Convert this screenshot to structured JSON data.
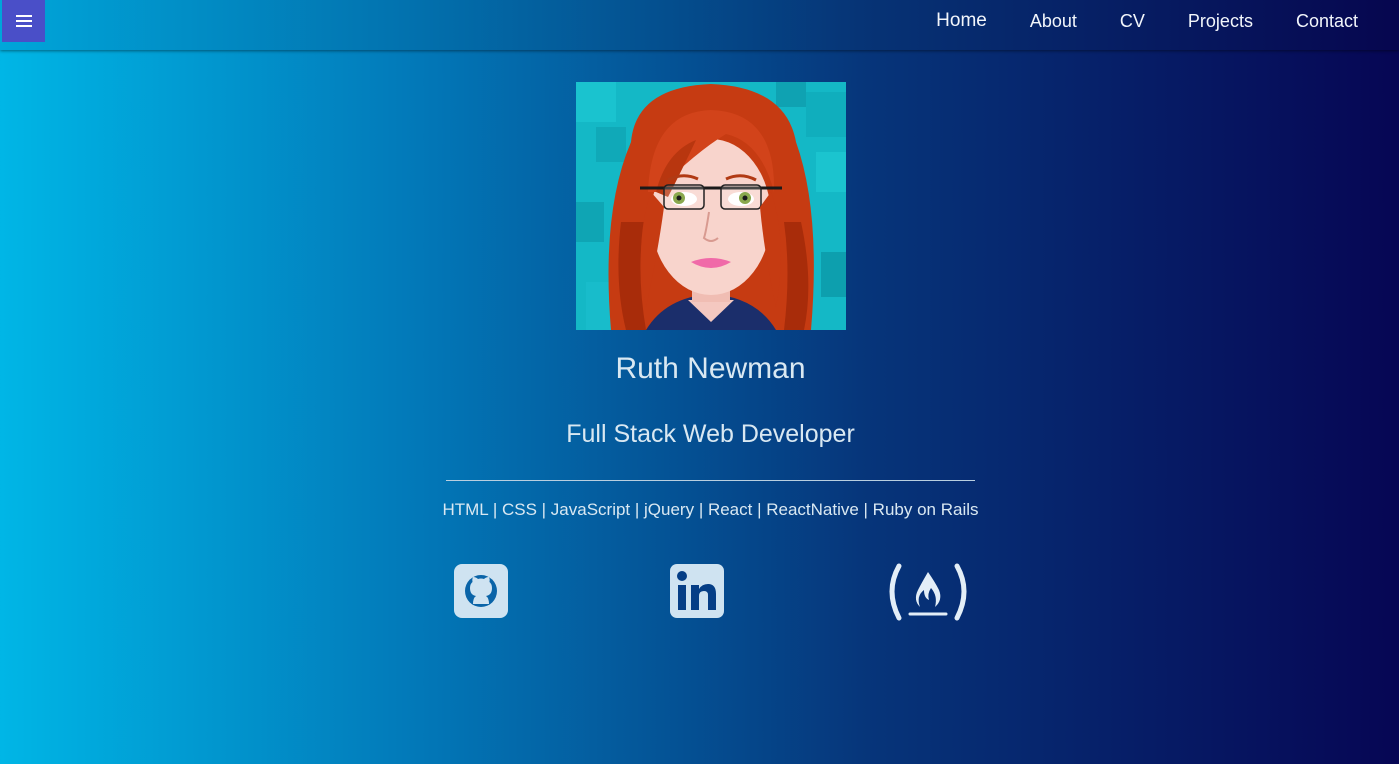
{
  "nav": {
    "menu_icon": "hamburger-menu-icon",
    "items": [
      {
        "label": "Home"
      },
      {
        "label": "About"
      },
      {
        "label": "CV"
      },
      {
        "label": "Projects"
      },
      {
        "label": "Contact"
      }
    ]
  },
  "profile": {
    "avatar_icon": "avatar-illustration",
    "name": "Ruth Newman",
    "role": "Full Stack Web Developer",
    "skills": "HTML | CSS | JavaScript | jQuery | React | ReactNative | Ruby on Rails"
  },
  "social": [
    {
      "icon": "github-icon"
    },
    {
      "icon": "linkedin-icon"
    },
    {
      "icon": "freecodecamp-icon"
    }
  ],
  "colors": {
    "menu_button": "#4a4fc8",
    "gradient_start": "#00b6e6",
    "gradient_end": "#060654",
    "text": "#d9e8f2"
  }
}
